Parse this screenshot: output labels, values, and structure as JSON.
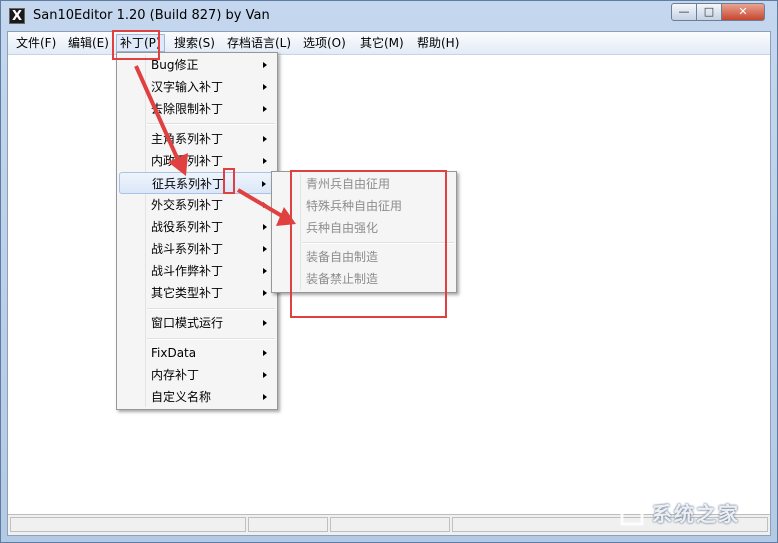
{
  "window": {
    "title": "San10Editor 1.20 (Build 827) by Van",
    "icon_letter": "X",
    "controls": {
      "minimize": "—",
      "maximize": "□",
      "close": "✕"
    }
  },
  "menubar": [
    {
      "label": "文件(F)"
    },
    {
      "label": "编辑(E)"
    },
    {
      "label": "补丁(P)",
      "active": true
    },
    {
      "label": "搜索(S)"
    },
    {
      "label": "存档语言(L)"
    },
    {
      "label": "选项(O)"
    },
    {
      "label": "其它(M)"
    },
    {
      "label": "帮助(H)"
    }
  ],
  "patch_menu": {
    "items": [
      "Bug修正",
      "汉字输入补丁",
      "去除限制补丁",
      "主角系列补丁",
      "内政系列补丁",
      "征兵系列补丁",
      "外交系列补丁",
      "战役系列补丁",
      "战斗系列补丁",
      "战斗作弊补丁",
      "其它类型补丁",
      "窗口模式运行",
      "FixData",
      "内存补丁",
      "自定义名称"
    ],
    "highlighted_index": 5
  },
  "conscription_submenu": {
    "items": [
      "青州兵自由征用",
      "特殊兵种自由征用",
      "兵种自由强化",
      "装备自由制造",
      "装备禁止制造"
    ]
  },
  "watermark": {
    "text": "系统之家"
  },
  "colors": {
    "annotation_red": "#e04040",
    "menu_highlight": "#dbe7f8"
  }
}
